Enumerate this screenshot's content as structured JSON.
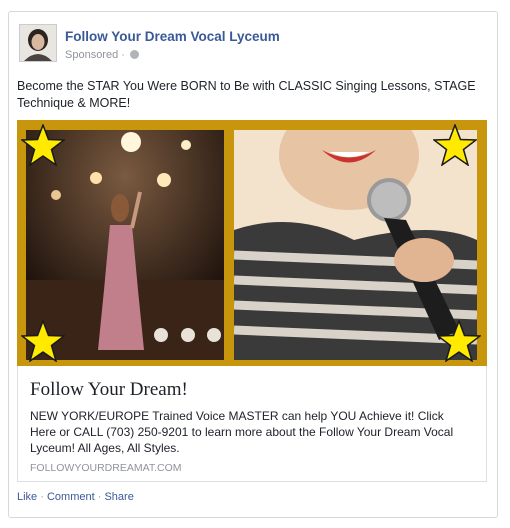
{
  "post": {
    "page_name": "Follow Your Dream Vocal Lyceum",
    "sponsored": "Sponsored",
    "sponsored_sep": "·",
    "text": "Become the STAR You Were BORN to Be with CLASSIC Singing Lessons, STAGE Technique & MORE!"
  },
  "link": {
    "title": "Follow Your Dream!",
    "description": "NEW YORK/EUROPE Trained Voice MASTER can help YOU Achieve it! Click Here or CALL (703) 250-9201 to learn more about the Follow Your Dream Vocal Lyceum! All Ages, All Styles.",
    "domain": "FOLLOWYOURDREAMAT.COM"
  },
  "actions": {
    "like": "Like",
    "comment": "Comment",
    "share": "Share",
    "sep": "·"
  },
  "colors": {
    "frame": "#c8960c",
    "star": "#ffea00",
    "link_blue": "#3b5998"
  },
  "icons": {
    "globe": "globe-icon",
    "star": "star-icon"
  }
}
